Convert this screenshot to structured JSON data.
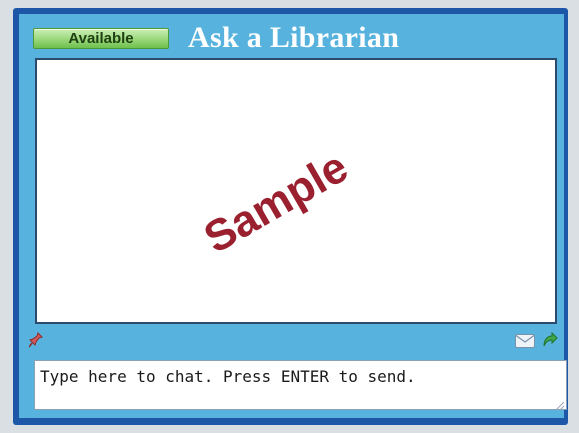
{
  "header": {
    "status_label": "Available",
    "title": "Ask a Librarian"
  },
  "transcript": {
    "watermark_text": "Sample"
  },
  "toolbar": {
    "left_icon": "pin-icon",
    "right_icons": [
      "email-icon",
      "popout-icon"
    ]
  },
  "input": {
    "placeholder": "Type here to chat. Press ENTER to send."
  },
  "colors": {
    "frame": "#1f57a8",
    "body": "#57b3de",
    "status_green": "#9ad77a",
    "watermark": "#9a2030"
  }
}
